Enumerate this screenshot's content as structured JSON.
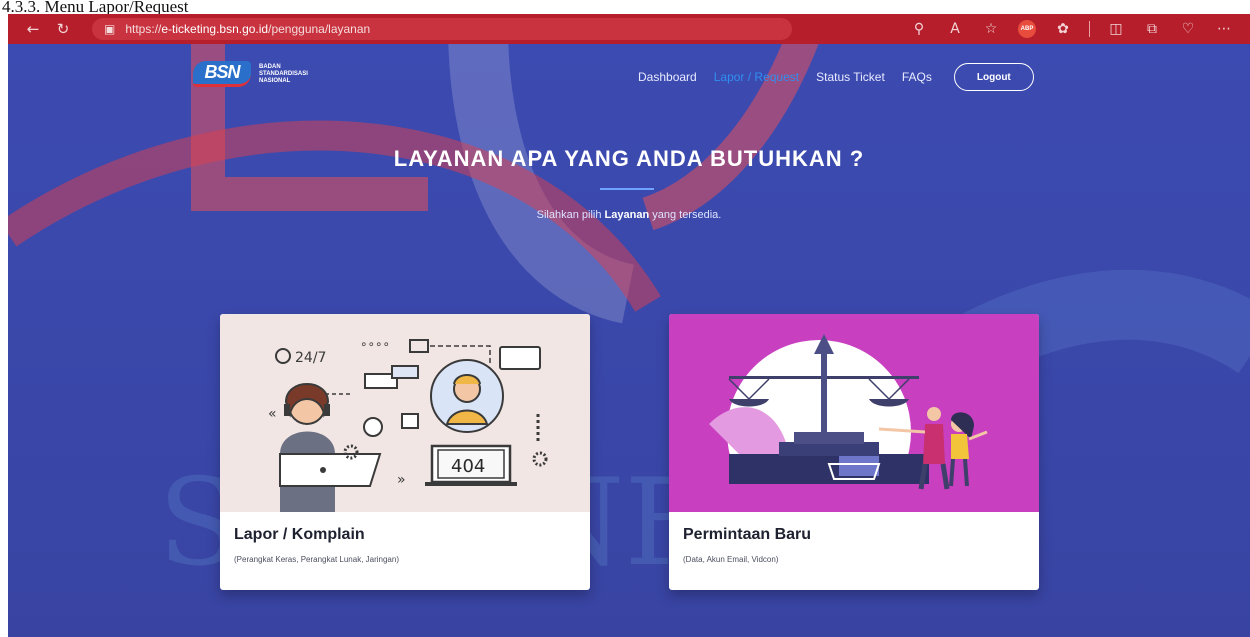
{
  "document": {
    "caption": "4.3.3.   Menu Lapor/Request"
  },
  "browser": {
    "url_prefix": "https://",
    "url_host": "e-ticketing.bsn.go.id",
    "url_path": "/pengguna/layanan",
    "icons": [
      "back-arrow-icon",
      "refresh-icon",
      "lock-icon",
      "zoom-icon",
      "read-aloud-icon",
      "favorite-star-icon",
      "adblock-icon",
      "extensions-icon",
      "split-screen-icon",
      "collections-icon",
      "health-icon",
      "more-icon"
    ],
    "abp_label": "ABP"
  },
  "site": {
    "logo": {
      "mark": "BSN",
      "line1": "BADAN",
      "line2": "STANDARDISASI",
      "line3": "NASIONAL"
    },
    "nav": {
      "dashboard": "Dashboard",
      "lapor": "Lapor / Request",
      "status": "Status Ticket",
      "faqs": "FAQs",
      "logout": "Logout"
    },
    "hero": {
      "title": "LAYANAN APA YANG ANDA BUTUHKAN ?",
      "sub_before": "Silahkan pilih ",
      "sub_bold": "Layanan",
      "sub_after": " yang tersedia."
    },
    "cards": [
      {
        "title": "Lapor / Komplain",
        "desc": "(Perangkat Keras, Perangkat Lunak, Jaringan)",
        "illustration_texts": [
          "24/7",
          "404"
        ]
      },
      {
        "title": "Permintaan Baru",
        "desc": "(Data, Akun Email, Vidcon)"
      }
    ]
  },
  "watermark": {
    "text": "STT - NF"
  },
  "colors": {
    "browser_bar": "#b51e2a",
    "page_bg": "#3b46a8",
    "active_nav": "#2f8ff0",
    "card2_bg": "#c83fbf",
    "card1_bg": "#f1e6e4"
  }
}
